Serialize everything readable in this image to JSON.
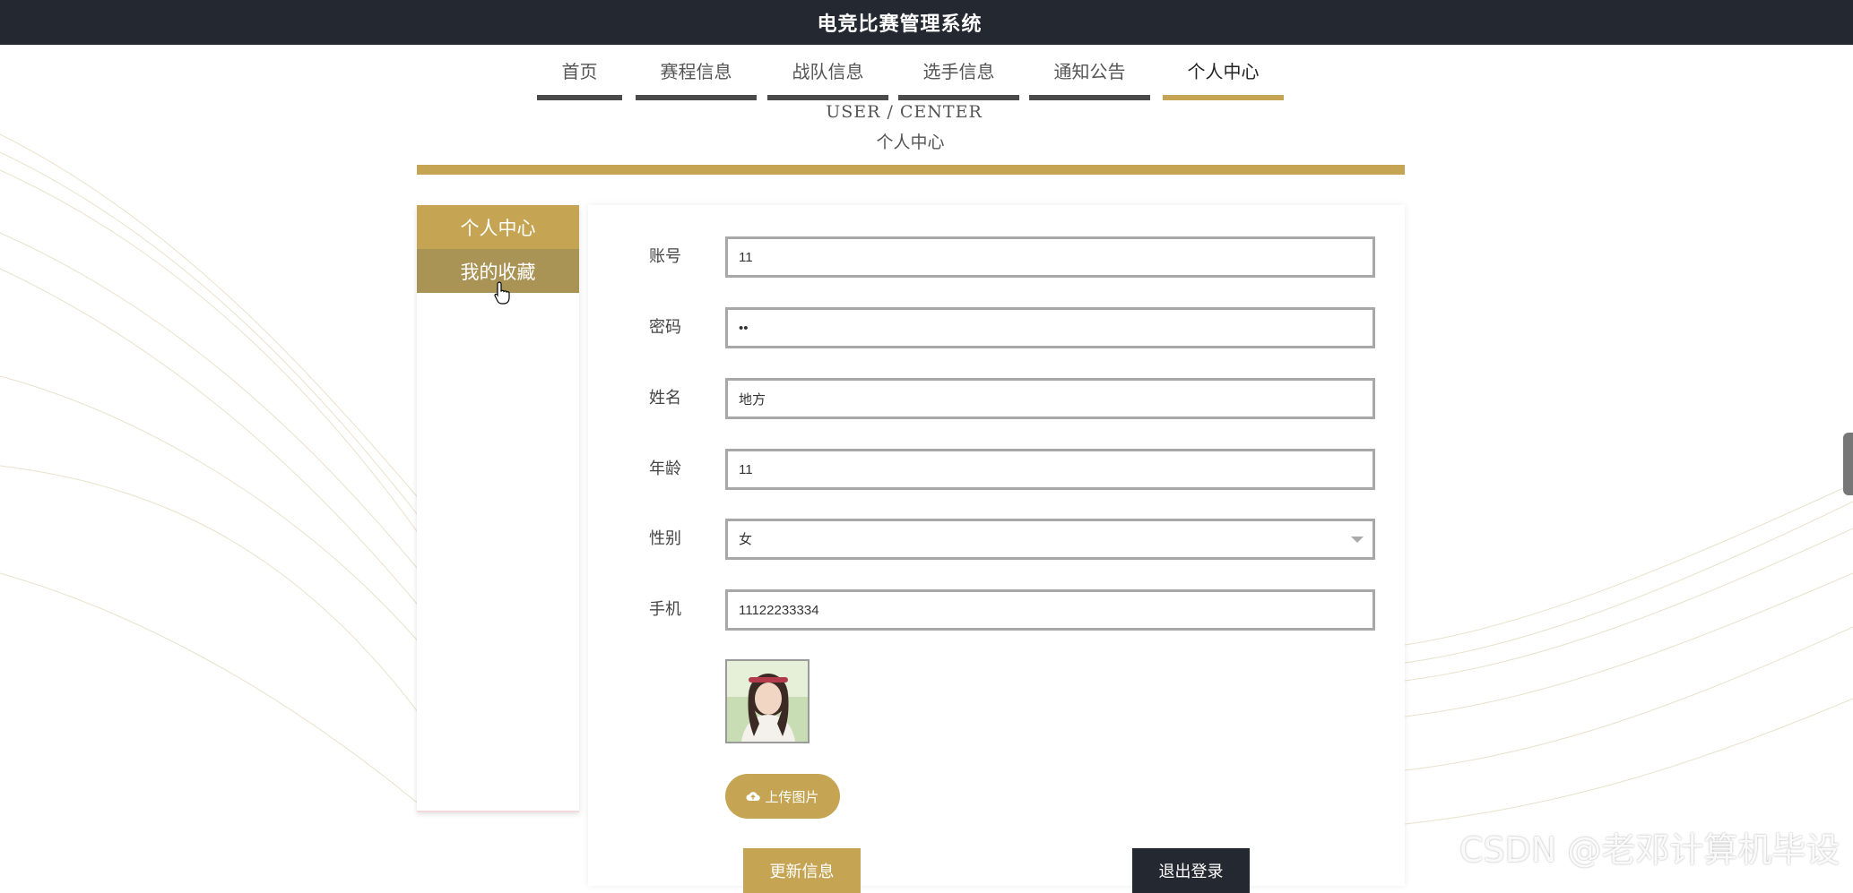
{
  "header": {
    "site_title": "电竞比赛管理系统"
  },
  "nav": {
    "items": [
      {
        "label": "首页"
      },
      {
        "label": "赛程信息"
      },
      {
        "label": "战队信息"
      },
      {
        "label": "选手信息"
      },
      {
        "label": "通知公告"
      },
      {
        "label": "个人中心",
        "active": true
      }
    ]
  },
  "page_header": {
    "en_title": "USER / CENTER",
    "cn_title": "个人中心"
  },
  "sidebar": {
    "items": [
      {
        "label": "个人中心"
      },
      {
        "label": "我的收藏"
      }
    ]
  },
  "form": {
    "account": {
      "label": "账号",
      "value": "11"
    },
    "password": {
      "label": "密码",
      "value": "11"
    },
    "name": {
      "label": "姓名",
      "value": "地方"
    },
    "age": {
      "label": "年龄",
      "value": "11"
    },
    "gender": {
      "label": "性别",
      "value": "女"
    },
    "phone": {
      "label": "手机",
      "value": "11122233334"
    }
  },
  "buttons": {
    "upload": "上传图片",
    "update": "更新信息",
    "logout": "退出登录"
  },
  "watermark": "CSDN @老邓计算机毕设",
  "colors": {
    "accent": "#c5a553",
    "topbar": "#242830"
  }
}
